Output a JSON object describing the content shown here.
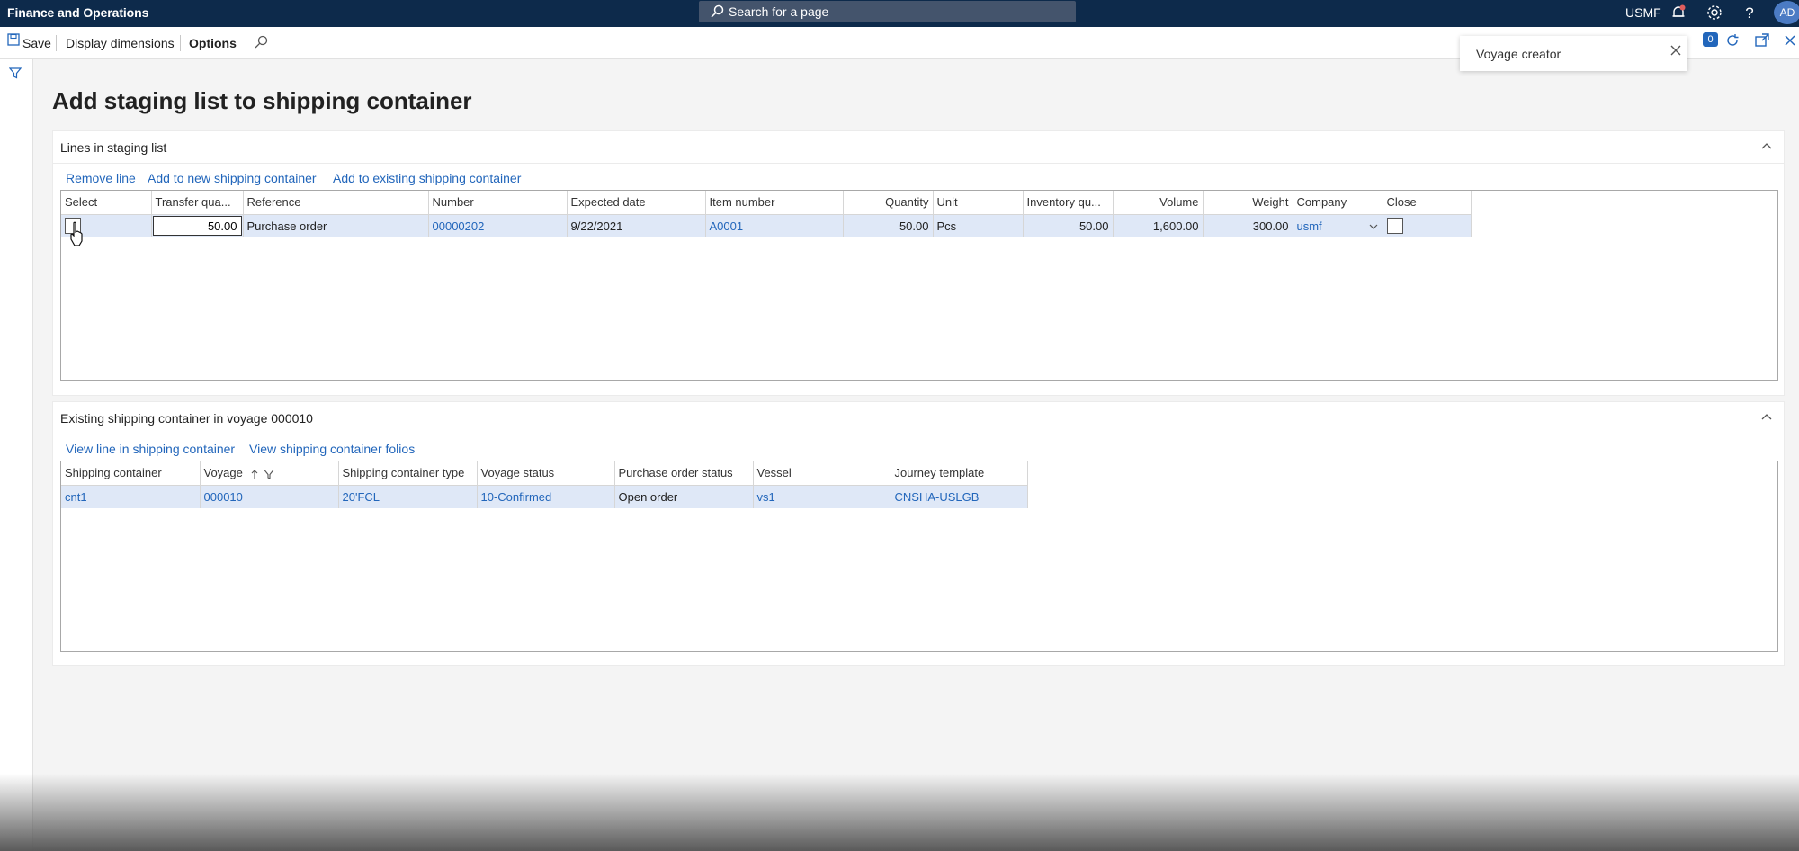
{
  "topbar": {
    "app_title": "Finance and Operations",
    "search_placeholder": "Search for a page",
    "company": "USMF",
    "avatar_initials": "AD"
  },
  "actionbar": {
    "save_label": "Save",
    "display_dimensions_label": "Display dimensions",
    "options_label": "Options",
    "notification_count": "0"
  },
  "toast": {
    "text": "Voyage creator"
  },
  "page": {
    "title": "Add staging list to shipping container"
  },
  "staging": {
    "header": "Lines in staging list",
    "actions": {
      "remove_line": "Remove line",
      "add_new": "Add to new shipping container",
      "add_existing": "Add to existing shipping container"
    },
    "columns": [
      "Select",
      "Transfer qua...",
      "Reference",
      "Number",
      "Expected date",
      "Item number",
      "Quantity",
      "Unit",
      "Inventory qu...",
      "Volume",
      "Weight",
      "Company",
      "Close"
    ],
    "row": {
      "transfer_qty": "50.00",
      "reference": "Purchase order",
      "number": "00000202",
      "expected_date": "9/22/2021",
      "item_number": "A0001",
      "quantity": "50.00",
      "unit": "Pcs",
      "inventory_qty": "50.00",
      "volume": "1,600.00",
      "weight": "300.00",
      "company": "usmf",
      "select_checked": false,
      "close_checked": false
    }
  },
  "existing": {
    "header": "Existing shipping container in voyage 000010",
    "actions": {
      "view_line": "View line in shipping container",
      "view_folios": "View shipping container folios"
    },
    "columns": [
      "Shipping container",
      "Voyage",
      "Shipping container type",
      "Voyage status",
      "Purchase order status",
      "Vessel",
      "Journey template"
    ],
    "row": {
      "shipping_container": "cnt1",
      "voyage": "000010",
      "container_type": "20'FCL",
      "voyage_status": "10-Confirmed",
      "po_status": "Open order",
      "vessel": "vs1",
      "journey_template": "CNSHA-USLGB"
    }
  },
  "colors": {
    "topbar": "#0d2a4b",
    "link": "#2266bb",
    "selected_row": "#dfe8f7"
  }
}
